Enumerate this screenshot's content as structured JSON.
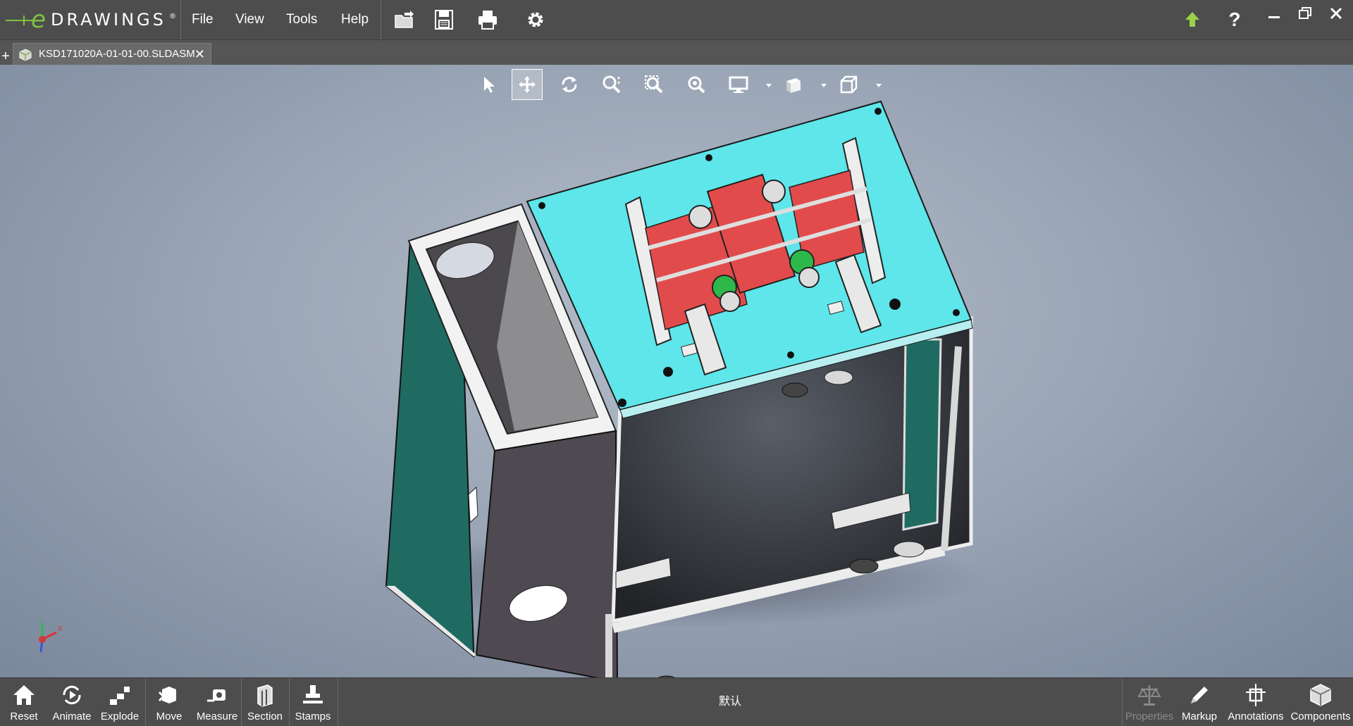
{
  "app": {
    "logo_letter": "e",
    "logo_text": "DRAWINGS",
    "logo_mark": "®"
  },
  "menu": {
    "file": "File",
    "view": "View",
    "tools": "Tools",
    "help": "Help"
  },
  "toolbar": {
    "icons": [
      "open-icon",
      "save-icon",
      "print-icon",
      "settings-icon"
    ]
  },
  "window": {
    "icons": [
      "upgrade-arrow-icon",
      "help-icon",
      "minimize-icon",
      "restore-icon",
      "close-icon"
    ],
    "help_label": "?"
  },
  "tabs": {
    "new_tab": "+",
    "document_title": "KSD171020A-01-01-00.SLDASM",
    "close": "✕"
  },
  "view_toolbar": {
    "icons": [
      "select-icon",
      "pan-icon",
      "rotate-icon",
      "zoom-icon",
      "zoom-to-area-icon",
      "zoom-to-fit-icon",
      "display-style-icon",
      "view-orientation-icon",
      "standard-views-icon"
    ],
    "active": "pan-icon"
  },
  "triad": {
    "x_label": "X",
    "y_label": "Y"
  },
  "bottom_toolbar": {
    "left": [
      {
        "label": "Reset",
        "icon": "home-icon"
      },
      {
        "label": "Animate",
        "icon": "animate-icon"
      },
      {
        "label": "Explode",
        "icon": "explode-icon"
      },
      {
        "label": "Move",
        "icon": "move-icon"
      },
      {
        "label": "Measure",
        "icon": "measure-icon"
      },
      {
        "label": "Section",
        "icon": "section-icon"
      },
      {
        "label": "Stamps",
        "icon": "stamp-icon"
      }
    ],
    "configuration": "默认",
    "right": [
      {
        "label": "Properties",
        "icon": "scales-icon",
        "enabled": false
      },
      {
        "label": "Markup",
        "icon": "pencil-icon",
        "enabled": true
      },
      {
        "label": "Annotations",
        "icon": "annotation-icon",
        "enabled": true
      },
      {
        "label": "Components",
        "icon": "components-icon",
        "enabled": true
      }
    ]
  },
  "colors": {
    "chrome": "#4d4d4d",
    "accent_green": "#7dc242",
    "cyan_plate": "#5ee6ea",
    "red_parts": "#e24b4b",
    "teal_panel": "#1f6b62"
  }
}
